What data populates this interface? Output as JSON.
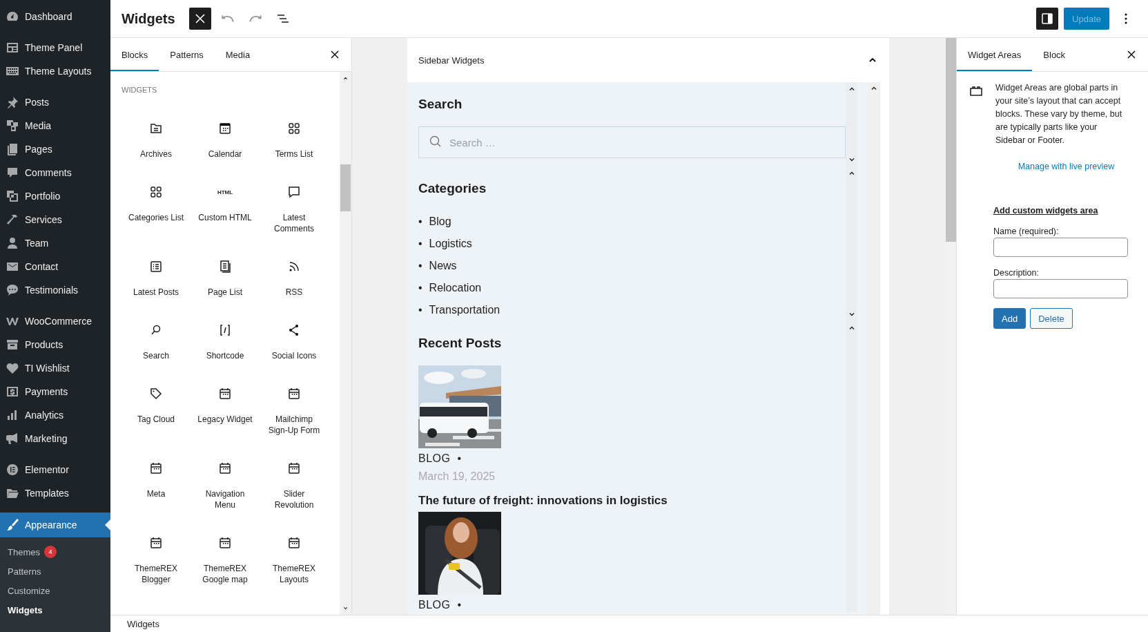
{
  "admin_menu": {
    "groups": [
      [
        {
          "label": "Dashboard",
          "selected": false
        }
      ],
      [
        {
          "label": "Theme Panel",
          "selected": false
        },
        {
          "label": "Theme Layouts",
          "selected": false
        }
      ],
      [
        {
          "label": "Posts",
          "selected": false
        },
        {
          "label": "Media",
          "selected": false
        },
        {
          "label": "Pages",
          "selected": false
        },
        {
          "label": "Comments",
          "selected": false
        },
        {
          "label": "Portfolio",
          "selected": false
        },
        {
          "label": "Services",
          "selected": false
        },
        {
          "label": "Team",
          "selected": false
        },
        {
          "label": "Contact",
          "selected": false
        },
        {
          "label": "Testimonials",
          "selected": false
        }
      ],
      [
        {
          "label": "WooCommerce",
          "selected": false
        },
        {
          "label": "Products",
          "selected": false
        },
        {
          "label": "TI Wishlist",
          "selected": false
        },
        {
          "label": "Payments",
          "selected": false
        },
        {
          "label": "Analytics",
          "selected": false
        },
        {
          "label": "Marketing",
          "selected": false
        }
      ],
      [
        {
          "label": "Elementor",
          "selected": false
        },
        {
          "label": "Templates",
          "selected": false
        }
      ],
      [
        {
          "label": "Appearance",
          "selected": true
        }
      ]
    ],
    "submenu": [
      {
        "label": "Themes",
        "badge": "4",
        "selected": false
      },
      {
        "label": "Patterns",
        "selected": false
      },
      {
        "label": "Customize",
        "selected": false
      },
      {
        "label": "Widgets",
        "selected": true
      }
    ]
  },
  "header": {
    "title": "Widgets",
    "inserter_open": true,
    "undo": {
      "disabled": true
    },
    "redo": {
      "disabled": true
    },
    "settings_open": true,
    "update": {
      "label": "Update",
      "disabled": true
    }
  },
  "inserter": {
    "tabs": [
      {
        "label": "Blocks",
        "selected": true
      },
      {
        "label": "Patterns",
        "selected": false
      },
      {
        "label": "Media",
        "selected": false
      }
    ],
    "section": "WIDGETS",
    "blocks": [
      {
        "label": "Archives"
      },
      {
        "label": "Calendar"
      },
      {
        "label": "Terms List"
      },
      {
        "label": "Categories List"
      },
      {
        "label": "Custom HTML",
        "icon_text": "HTML"
      },
      {
        "label": "Latest Comments"
      },
      {
        "label": "Latest Posts"
      },
      {
        "label": "Page List"
      },
      {
        "label": "RSS"
      },
      {
        "label": "Search"
      },
      {
        "label": "Shortcode"
      },
      {
        "label": "Social Icons"
      },
      {
        "label": "Tag Cloud"
      },
      {
        "label": "Legacy Widget"
      },
      {
        "label": "Mailchimp Sign-Up Form"
      },
      {
        "label": "Meta"
      },
      {
        "label": "Navigation Menu"
      },
      {
        "label": "Slider Revolution"
      },
      {
        "label": "ThemeREX Blogger"
      },
      {
        "label": "ThemeREX Google map"
      },
      {
        "label": "ThemeREX Layouts"
      }
    ]
  },
  "canvas": {
    "area_title": "Sidebar Widgets",
    "expanded": true,
    "blocks": [
      {
        "kind": "search",
        "heading": "Search",
        "placeholder": "Search …"
      },
      {
        "kind": "list",
        "heading": "Categories",
        "bullet": "•",
        "items": [
          "Blog",
          "Logistics",
          "News",
          "Relocation",
          "Transportation"
        ]
      },
      {
        "kind": "posts",
        "heading": "Recent Posts",
        "posts": [
          {
            "category": "BLOG",
            "separator": "•",
            "date": "March 19, 2025",
            "title": "The future of freight: innovations in logistics"
          },
          {
            "category": "BLOG",
            "separator": "•"
          }
        ]
      }
    ]
  },
  "settings": {
    "tabs": [
      {
        "label": "Widget Areas",
        "selected": true
      },
      {
        "label": "Block",
        "selected": false
      }
    ],
    "description": "Widget Areas are global parts in your site’s layout that can accept blocks. These vary by theme, but are typically parts like your Sidebar or Footer.",
    "link": "Manage with live preview",
    "form": {
      "title": "Add custom widgets area",
      "fields": [
        {
          "label": "Name (required):"
        },
        {
          "label": "Description:"
        }
      ],
      "buttons": [
        {
          "label": "Add",
          "kind": "primary"
        },
        {
          "label": "Delete",
          "kind": "secondary"
        }
      ]
    }
  },
  "footer": {
    "breadcrumb": "Widgets"
  }
}
